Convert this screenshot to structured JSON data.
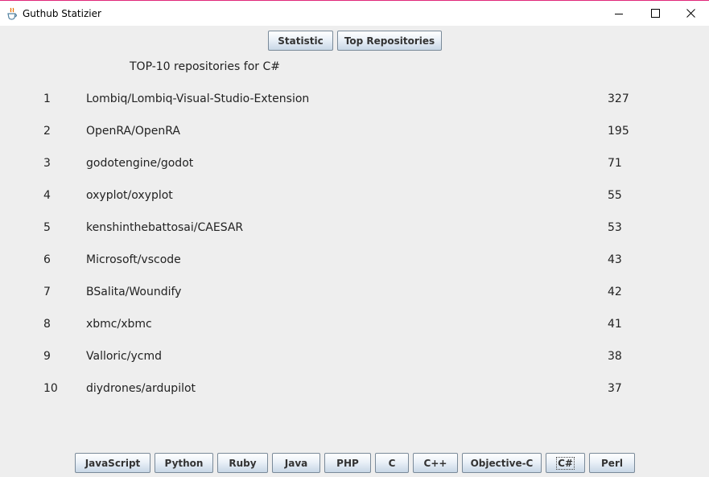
{
  "window": {
    "title": "Guthub Statizier"
  },
  "top_nav": {
    "statistic_label": "Statistic",
    "top_repos_label": "Top Repositories"
  },
  "main": {
    "heading": "TOP-10 repositories for C#",
    "rows": [
      {
        "rank": "1",
        "name": "Lombiq/Lombiq-Visual-Studio-Extension",
        "stars": "327"
      },
      {
        "rank": "2",
        "name": "OpenRA/OpenRA",
        "stars": "195"
      },
      {
        "rank": "3",
        "name": "godotengine/godot",
        "stars": "71"
      },
      {
        "rank": "4",
        "name": "oxyplot/oxyplot",
        "stars": "55"
      },
      {
        "rank": "5",
        "name": "kenshinthebattosai/CAESAR",
        "stars": "53"
      },
      {
        "rank": "6",
        "name": "Microsoft/vscode",
        "stars": "43"
      },
      {
        "rank": "7",
        "name": "BSalita/Woundify",
        "stars": "42"
      },
      {
        "rank": "8",
        "name": "xbmc/xbmc",
        "stars": "41"
      },
      {
        "rank": "9",
        "name": "Valloric/ycmd",
        "stars": "38"
      },
      {
        "rank": "10",
        "name": "diydrones/ardupilot",
        "stars": "37"
      }
    ]
  },
  "languages": {
    "items": [
      "JavaScript",
      "Python",
      "Ruby",
      "Java",
      "PHP",
      "C",
      "C++",
      "Objective-C",
      "C#",
      "Perl"
    ],
    "selected": "C#"
  },
  "icons": {
    "app": "java-cup-icon",
    "minimize": "minimize-icon",
    "maximize": "maximize-icon",
    "close": "close-icon"
  }
}
